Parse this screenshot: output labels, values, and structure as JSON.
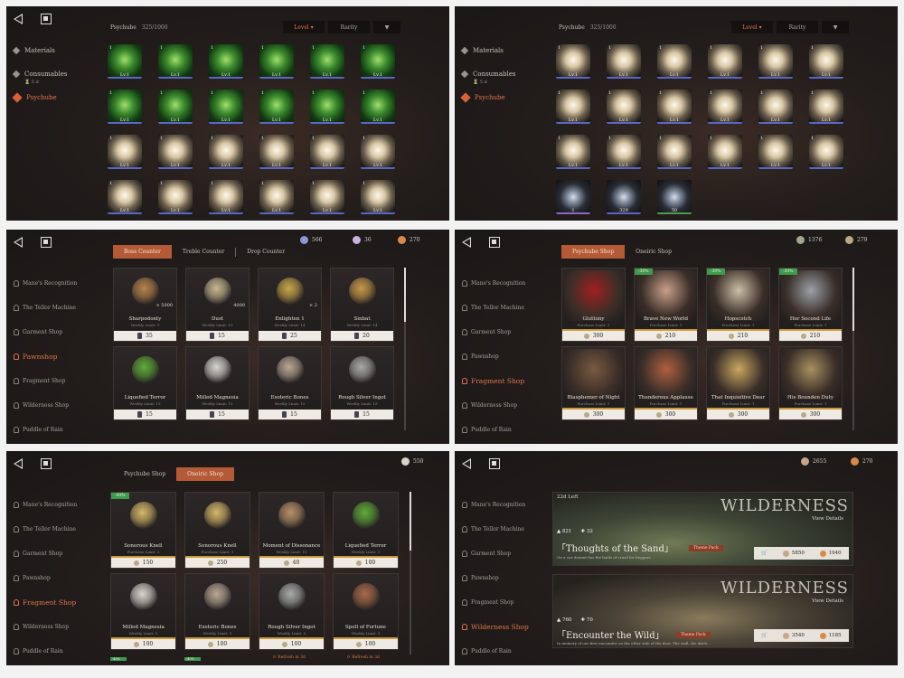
{
  "inventory1": {
    "header_title": "Psychube",
    "header_count": "325/1000",
    "filters": [
      "Level",
      "Rarity",
      ""
    ],
    "menu": [
      {
        "label": "Materials"
      },
      {
        "label": "Consumables",
        "sub": "⏳ 5 d"
      },
      {
        "label": "Psychube"
      }
    ],
    "cell_level": "Lv.1",
    "cell_qty": "1"
  },
  "inventory2": {
    "header_title": "Psychube",
    "header_count": "325/1000",
    "filters": [
      "Level",
      "Rarity",
      ""
    ],
    "last_row_counts": [
      "1",
      "329",
      "50"
    ]
  },
  "pawnshop": {
    "tabs": [
      "Boss Counter",
      "Treble Counter",
      "Drop Counter"
    ],
    "currency": [
      {
        "value": "566",
        "color": "#8b98d8"
      },
      {
        "value": "36",
        "color": "#c9b2e0"
      },
      {
        "value": "270",
        "color": "#d98a4a"
      }
    ],
    "menu": [
      "Mane's Recognition",
      "The Tellor Machine",
      "Garment Shop",
      "Pawnshop",
      "Fragment Shop",
      "Wilderness Shop",
      "Puddle of Rain"
    ],
    "active": "Pawnshop",
    "items": [
      {
        "name": "Sharpodonty",
        "limit": "Weekly Limit: 9",
        "count": "× 5000",
        "price": "35"
      },
      {
        "name": "Dust",
        "limit": "Weekly Limit: 19",
        "count": "4000",
        "price": "15"
      },
      {
        "name": "Enlighten 1",
        "limit": "Weekly Limit: 14",
        "count": "× 2",
        "price": "25"
      },
      {
        "name": "Sinbat",
        "limit": "Weekly Limit: 14",
        "count": "",
        "price": "20"
      },
      {
        "name": "Liquefied Terror",
        "limit": "Weekly Limit: 15",
        "count": "",
        "price": "15"
      },
      {
        "name": "Milled Magnesia",
        "limit": "Weekly Limit: 15",
        "count": "",
        "price": "15"
      },
      {
        "name": "Esoteric Bones",
        "limit": "Weekly Limit: 15",
        "count": "",
        "price": "15"
      },
      {
        "name": "Rough Silver Ingot",
        "limit": "Weekly Limit: 15",
        "count": "",
        "price": "15"
      }
    ]
  },
  "psychubeshop": {
    "tabs": [
      "Psychube Shop",
      "Oneiric Shop"
    ],
    "currency": [
      {
        "value": "1376",
        "color": "#9fa88a"
      },
      {
        "value": "279",
        "color": "#bba880"
      }
    ],
    "menu": [
      "Mane's Recognition",
      "The Tellor Machine",
      "Garment Shop",
      "Pawnshop",
      "Fragment Shop",
      "Wilderness Shop",
      "Puddle of Rain"
    ],
    "active": "Fragment Shop",
    "items": [
      {
        "name": "Gluttony",
        "limit": "Purchase Limit: 1",
        "price": "300",
        "badge": ""
      },
      {
        "name": "Brave New World",
        "limit": "Purchase Limit: 1",
        "price": "210",
        "badge": "-30%"
      },
      {
        "name": "Hopscotch",
        "limit": "Purchase Limit: 1",
        "price": "210",
        "badge": "-30%"
      },
      {
        "name": "Her Second Life",
        "limit": "Purchase Limit: 1",
        "price": "210",
        "badge": "-30%"
      },
      {
        "name": "Blasphemer of Night",
        "limit": "Purchase Limit: 1",
        "price": "300",
        "badge": ""
      },
      {
        "name": "Thunderous Applause",
        "limit": "Purchase Limit: 1",
        "price": "300",
        "badge": ""
      },
      {
        "name": "That Inquisitive Dear",
        "limit": "Purchase Limit: 1",
        "price": "300",
        "badge": ""
      },
      {
        "name": "His Bounden Duty",
        "limit": "Purchase Limit: 1",
        "price": "300",
        "badge": ""
      }
    ]
  },
  "oneiricshop": {
    "tabs": [
      "Psychube Shop",
      "Oneiric Shop"
    ],
    "currency": [
      {
        "value": "550",
        "color": "#d8d4cc"
      }
    ],
    "menu": [
      "Mane's Recognition",
      "The Tellor Machine",
      "Garment Shop",
      "Pawnshop",
      "Fragment Shop",
      "Wilderness Shop",
      "Puddle of Rain"
    ],
    "active": "Fragment Shop",
    "items": [
      {
        "name": "Sonorous Knell",
        "limit": "Purchase Limit: 3",
        "price": "150",
        "badge": "-40%"
      },
      {
        "name": "Sonorous Knell",
        "limit": "Purchase Limit: 1",
        "price": "250",
        "badge": ""
      },
      {
        "name": "Moment of Dissonance",
        "limit": "Weekly Limit: 10",
        "price": "40",
        "badge": ""
      },
      {
        "name": "Liquefied Terror",
        "limit": "Weekly Limit: 5",
        "price": "100",
        "badge": ""
      },
      {
        "name": "Milled Magnesia",
        "limit": "Weekly Limit: 5",
        "price": "100",
        "badge": ""
      },
      {
        "name": "Esoteric Bones",
        "limit": "Weekly Limit: 5",
        "price": "100",
        "badge": ""
      },
      {
        "name": "Rough Silver Ingot",
        "limit": "Weekly Limit: 5",
        "price": "100",
        "badge": ""
      },
      {
        "name": "Spell of Fortune",
        "limit": "Weekly Limit: 5",
        "price": "100",
        "badge": ""
      }
    ],
    "bottom_badges": [
      "-40%",
      "-40%"
    ],
    "refresh": [
      "Refresh in 3d",
      "Refresh in 3d"
    ]
  },
  "wilderness": {
    "currency": [
      {
        "value": "2655",
        "color": "#c9a58a"
      },
      {
        "value": "270",
        "color": "#d98a4a"
      }
    ],
    "menu": [
      "Mane's Recognition",
      "The Tellor Machine",
      "Garment Shop",
      "Pawnshop",
      "Fragment Shop",
      "Wilderness Shop",
      "Puddle of Rain"
    ],
    "active": "Wilderness Shop",
    "banners": [
      {
        "time_left": "22d Left",
        "title": "WILDERNESS",
        "view": "View Details",
        "name": "「Thoughts of the Sand」",
        "desc": "On a sea distant lies the lands of crawl for beggars.",
        "stat1": "821",
        "stat2": "32",
        "theme": "Theme Pack",
        "price1": "5850",
        "price2": "1940"
      },
      {
        "time_left": "",
        "title": "WILDERNESS",
        "view": "View Details",
        "name": "「Encounter the Wild」",
        "desc": "In memory of our first encounter on the other side of the door. The wall, the ditch...",
        "stat1": "760",
        "stat2": "70",
        "theme": "Theme Pack",
        "price1": "3540",
        "price2": "1185"
      }
    ]
  }
}
